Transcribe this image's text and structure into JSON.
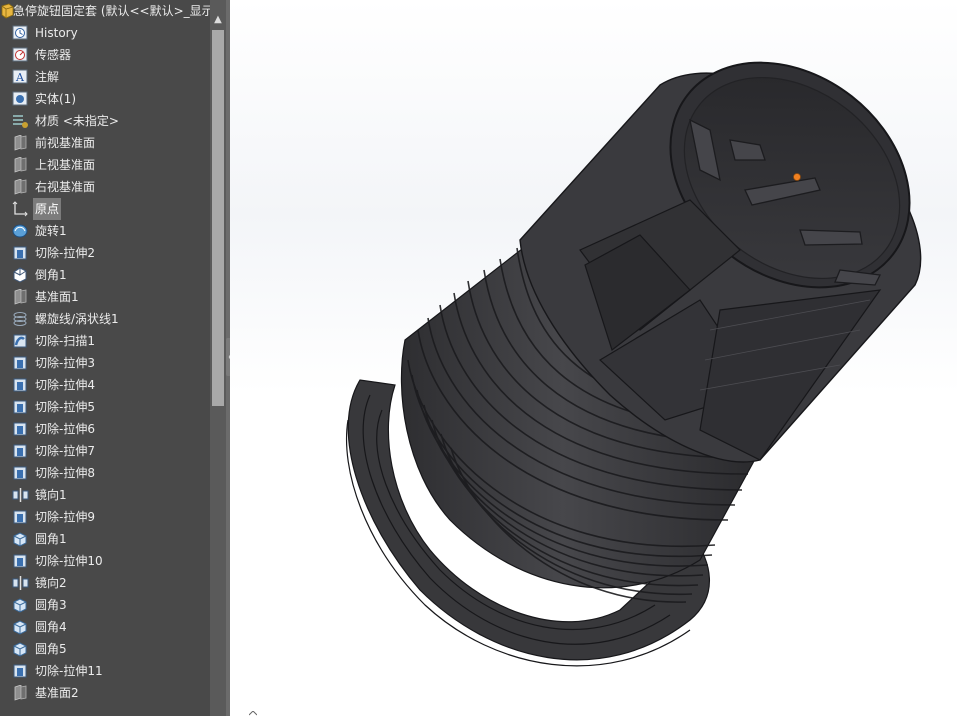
{
  "feature_tree": {
    "root_label": "急停旋钮固定套  (默认<<默认>_显示",
    "items": [
      {
        "label": "History",
        "icon": "history-icon"
      },
      {
        "label": "传感器",
        "icon": "sensor-icon"
      },
      {
        "label": "注解",
        "icon": "annotation-icon"
      },
      {
        "label": "实体(1)",
        "icon": "solid-bodies-icon"
      },
      {
        "label": "材质 <未指定>",
        "icon": "material-icon"
      },
      {
        "label": "前视基准面",
        "icon": "plane-icon"
      },
      {
        "label": "上视基准面",
        "icon": "plane-icon"
      },
      {
        "label": "右视基准面",
        "icon": "plane-icon"
      },
      {
        "label": "原点",
        "icon": "origin-icon",
        "selected": true
      },
      {
        "label": "旋转1",
        "icon": "revolve-icon"
      },
      {
        "label": "切除-拉伸2",
        "icon": "cut-extrude-icon"
      },
      {
        "label": "倒角1",
        "icon": "chamfer-icon"
      },
      {
        "label": "基准面1",
        "icon": "plane-icon"
      },
      {
        "label": "螺旋线/涡状线1",
        "icon": "helix-icon"
      },
      {
        "label": "切除-扫描1",
        "icon": "cut-sweep-icon"
      },
      {
        "label": "切除-拉伸3",
        "icon": "cut-extrude-icon"
      },
      {
        "label": "切除-拉伸4",
        "icon": "cut-extrude-icon"
      },
      {
        "label": "切除-拉伸5",
        "icon": "cut-extrude-icon"
      },
      {
        "label": "切除-拉伸6",
        "icon": "cut-extrude-icon"
      },
      {
        "label": "切除-拉伸7",
        "icon": "cut-extrude-icon"
      },
      {
        "label": "切除-拉伸8",
        "icon": "cut-extrude-icon"
      },
      {
        "label": "镜向1",
        "icon": "mirror-icon"
      },
      {
        "label": "切除-拉伸9",
        "icon": "cut-extrude-icon"
      },
      {
        "label": "圆角1",
        "icon": "fillet-icon"
      },
      {
        "label": "切除-拉伸10",
        "icon": "cut-extrude-icon"
      },
      {
        "label": "镜向2",
        "icon": "mirror-icon"
      },
      {
        "label": "圆角3",
        "icon": "fillet-icon"
      },
      {
        "label": "圆角4",
        "icon": "fillet-icon"
      },
      {
        "label": "圆角5",
        "icon": "fillet-icon"
      },
      {
        "label": "切除-拉伸11",
        "icon": "cut-extrude-icon"
      },
      {
        "label": "基准面2",
        "icon": "plane-icon"
      }
    ]
  },
  "colors": {
    "tree_background": "#494949",
    "tree_text": "#ececec",
    "model_body": "#3a3a3d",
    "model_edge": "#1a1a1c",
    "sketch_point": "#f08020"
  },
  "viewport": {
    "model_name": "knob-holder-sleeve-model"
  }
}
